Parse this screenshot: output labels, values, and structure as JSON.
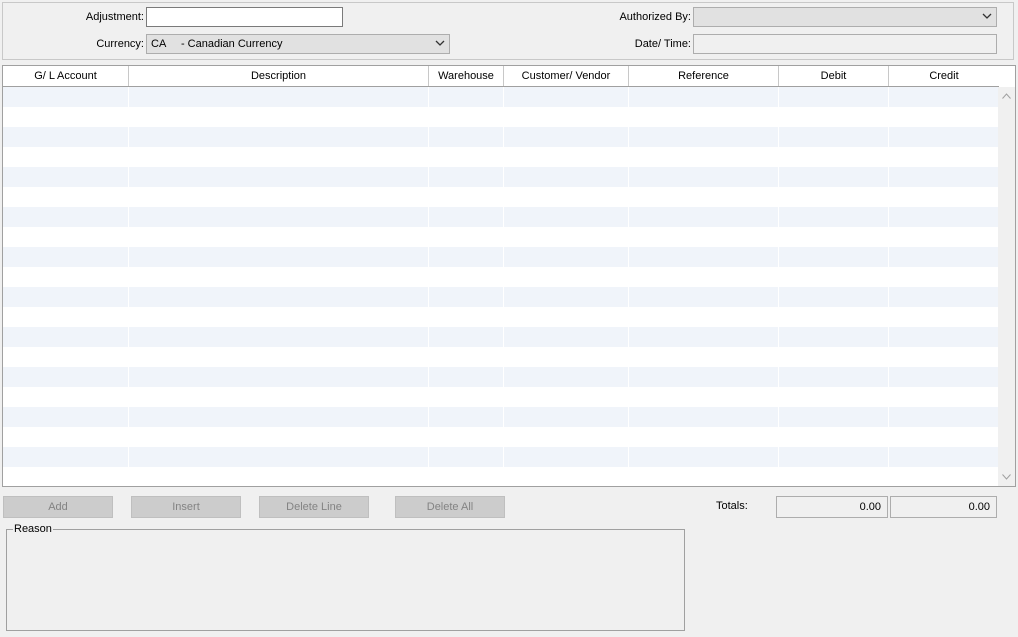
{
  "header": {
    "adjustment_label": "Adjustment:",
    "adjustment_value": "",
    "currency_label": "Currency:",
    "currency_value": "CA     - Canadian Currency",
    "authorized_by_label": "Authorized By:",
    "authorized_by_value": "",
    "datetime_label": "Date/ Time:",
    "datetime_value": ""
  },
  "grid": {
    "columns": [
      "G/ L Account",
      "Description",
      "Warehouse",
      "Customer/ Vendor",
      "Reference",
      "Debit",
      "Credit"
    ]
  },
  "buttons": {
    "add": "Add",
    "insert": "Insert",
    "delete_line": "Delete Line",
    "delete_all": "Delete All"
  },
  "totals": {
    "label": "Totals:",
    "debit": "0.00",
    "credit": "0.00"
  },
  "reason": {
    "label": "Reason",
    "value": ""
  },
  "icons": {
    "dropdown": "chevron-down-icon",
    "scroll_up": "scroll-up-arrow-icon",
    "scroll_down": "scroll-down-arrow-icon"
  },
  "colors": {
    "alt_row": "#f0f4fa",
    "disabled_button": "#cccccc"
  }
}
